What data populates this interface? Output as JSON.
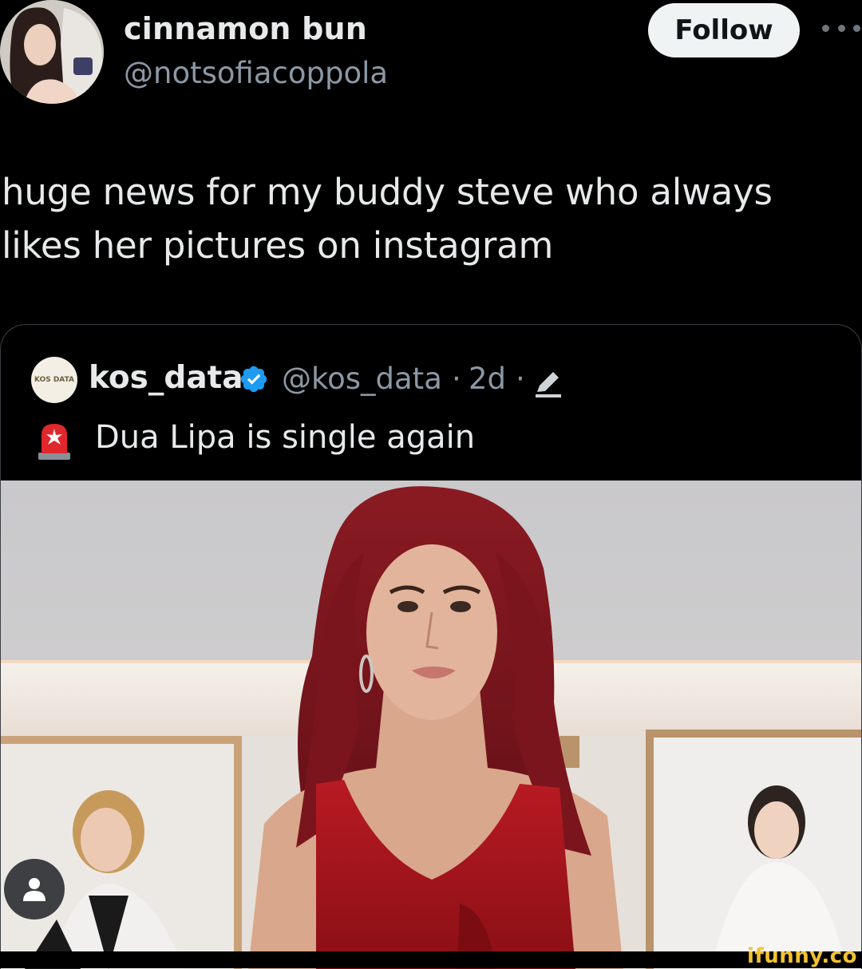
{
  "author": {
    "display_name": "cinnamon bun",
    "handle": "@notsofiacoppola",
    "follow_label": "Follow"
  },
  "tweet": {
    "text": "huge news for my buddy steve who always likes her pictures on instagram"
  },
  "quote": {
    "display_name": "kos_data",
    "handle": "@kos_data",
    "separator": "·",
    "time": "2d",
    "emoji": "🚨",
    "text": "Dua Lipa is single again",
    "avatar_text": "KOS DATA"
  },
  "colors": {
    "background": "#000000",
    "text_primary": "#e7e9ea",
    "text_secondary": "#8b98a5",
    "verified": "#1d9bf0",
    "follow_bg": "#eff3f4"
  },
  "icons": {
    "more": "more-horizontal-icon",
    "verified": "verified-badge-icon",
    "edited": "edit-pencil-icon",
    "siren": "siren-emoji-icon",
    "profile": "person-icon"
  },
  "watermark": "ifunny.co"
}
